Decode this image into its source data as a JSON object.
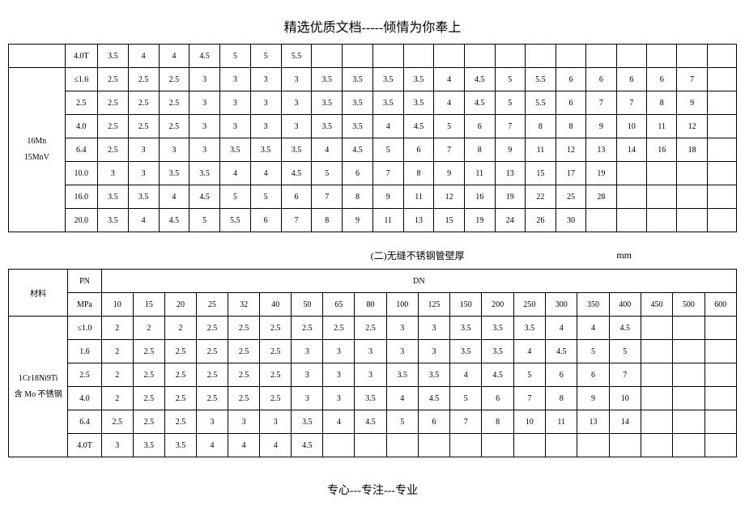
{
  "header": "精选优质文档-----倾情为你奉上",
  "footer": "专心---专注---专业",
  "table1": {
    "material": "16Mn\n15MnV",
    "rows": [
      {
        "pn": "4.0T",
        "vals": [
          "3.5",
          "4",
          "4",
          "4.5",
          "5",
          "5",
          "5.5",
          "",
          "",
          "",
          "",
          "",
          "",
          "",
          "",
          "",
          "",
          "",
          "",
          "",
          ""
        ]
      },
      {
        "pn": "≤1.6",
        "vals": [
          "2.5",
          "2.5",
          "2.5",
          "3",
          "3",
          "3",
          "3",
          "3.5",
          "3.5",
          "3.5",
          "3.5",
          "4",
          "4.5",
          "5",
          "5.5",
          "6",
          "6",
          "6",
          "6",
          "7",
          ""
        ]
      },
      {
        "pn": "2.5",
        "vals": [
          "2.5",
          "2.5",
          "2.5",
          "3",
          "3",
          "3",
          "3",
          "3.5",
          "3.5",
          "3.5",
          "3.5",
          "4",
          "4.5",
          "5",
          "5.5",
          "6",
          "7",
          "7",
          "8",
          "9",
          ""
        ]
      },
      {
        "pn": "4.0",
        "vals": [
          "2.5",
          "2.5",
          "2.5",
          "3",
          "3",
          "3",
          "3",
          "3.5",
          "3.5",
          "4",
          "4.5",
          "5",
          "6",
          "7",
          "8",
          "8",
          "9",
          "10",
          "11",
          "12",
          ""
        ]
      },
      {
        "pn": "6.4",
        "vals": [
          "2.5",
          "3",
          "3",
          "3",
          "3.5",
          "3.5",
          "3.5",
          "4",
          "4.5",
          "5",
          "6",
          "7",
          "8",
          "9",
          "11",
          "12",
          "13",
          "14",
          "16",
          "18",
          ""
        ]
      },
      {
        "pn": "10.0",
        "vals": [
          "3",
          "3",
          "3.5",
          "3.5",
          "4",
          "4",
          "4.5",
          "5",
          "6",
          "7",
          "8",
          "9",
          "11",
          "13",
          "15",
          "17",
          "19",
          "",
          "",
          "",
          ""
        ]
      },
      {
        "pn": "16.0",
        "vals": [
          "3.5",
          "3.5",
          "4",
          "4.5",
          "5",
          "5",
          "6",
          "7",
          "8",
          "9",
          "11",
          "12",
          "16",
          "19",
          "22",
          "25",
          "28",
          "",
          "",
          "",
          ""
        ]
      },
      {
        "pn": "20.0",
        "vals": [
          "3.5",
          "4",
          "4.5",
          "5",
          "5.5",
          "6",
          "7",
          "8",
          "9",
          "11",
          "13",
          "15",
          "19",
          "24",
          "26",
          "30",
          "",
          "",
          "",
          "",
          ""
        ]
      }
    ]
  },
  "table2": {
    "section_title": "(二)无缝不锈钢管壁厚",
    "unit": "mm",
    "material_label": "材料",
    "pn_label": "PN",
    "pn_unit": "MPa",
    "dn_label": "DN",
    "dn_cols": [
      "10",
      "15",
      "20",
      "25",
      "32",
      "40",
      "50",
      "65",
      "80",
      "100",
      "125",
      "150",
      "200",
      "250",
      "300",
      "350",
      "400",
      "450",
      "500",
      "600"
    ],
    "material": "1Cr18Ni9Ti\n含 Mo 不锈钢",
    "rows": [
      {
        "pn": "≤1.0",
        "vals": [
          "2",
          "2",
          "2",
          "2.5",
          "2.5",
          "2.5",
          "2.5",
          "2.5",
          "2.5",
          "3",
          "3",
          "3.5",
          "3.5",
          "3.5",
          "4",
          "4",
          "4.5",
          "",
          "",
          ""
        ]
      },
      {
        "pn": "1.6",
        "vals": [
          "2",
          "2.5",
          "2.5",
          "2.5",
          "2.5",
          "2.5",
          "3",
          "3",
          "3",
          "3",
          "3",
          "3.5",
          "3.5",
          "4",
          "4.5",
          "5",
          "5",
          "",
          "",
          ""
        ]
      },
      {
        "pn": "2.5",
        "vals": [
          "2",
          "2.5",
          "2.5",
          "2.5",
          "2.5",
          "2.5",
          "3",
          "3",
          "3",
          "3.5",
          "3.5",
          "4",
          "4.5",
          "5",
          "6",
          "6",
          "7",
          "",
          "",
          ""
        ]
      },
      {
        "pn": "4.0",
        "vals": [
          "2",
          "2.5",
          "2.5",
          "2.5",
          "2.5",
          "2.5",
          "3",
          "3",
          "3.5",
          "4",
          "4.5",
          "5",
          "6",
          "7",
          "8",
          "9",
          "10",
          "",
          "",
          ""
        ]
      },
      {
        "pn": "6.4",
        "vals": [
          "2.5",
          "2.5",
          "2.5",
          "3",
          "3",
          "3",
          "3.5",
          "4",
          "4.5",
          "5",
          "6",
          "7",
          "8",
          "10",
          "11",
          "13",
          "14",
          "",
          "",
          ""
        ]
      },
      {
        "pn": "4.0T",
        "vals": [
          "3",
          "3.5",
          "3.5",
          "4",
          "4",
          "4",
          "4.5",
          "",
          "",
          "",
          "",
          "",
          "",
          "",
          "",
          "",
          "",
          "",
          "",
          ""
        ]
      }
    ]
  }
}
